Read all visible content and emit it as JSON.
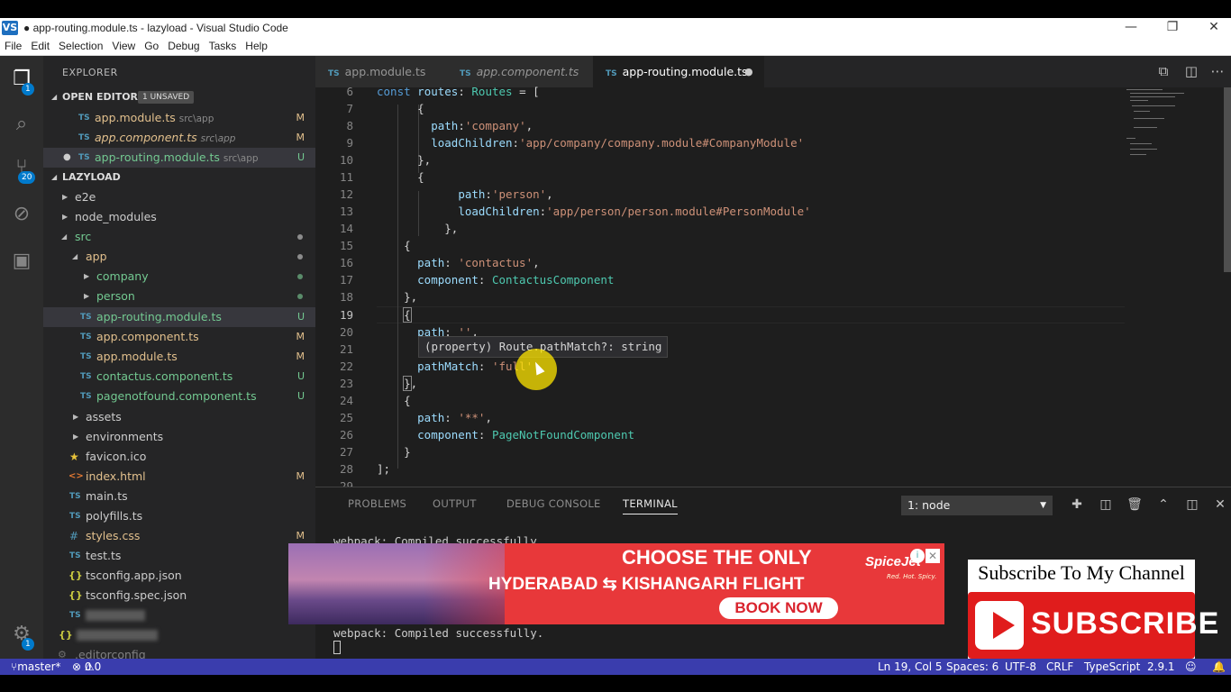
{
  "window": {
    "title": "● app-routing.module.ts - lazyload - Visual Studio Code",
    "logo": "VS",
    "controls": [
      "—",
      "❐",
      "✕"
    ]
  },
  "menu": [
    "File",
    "Edit",
    "Selection",
    "View",
    "Go",
    "Debug",
    "Tasks",
    "Help"
  ],
  "activity": {
    "explorer_badge": "1",
    "git_badge": "20",
    "settings_badge": "1"
  },
  "sidebar": {
    "title": "EXPLORER",
    "open_editors": {
      "header": "OPEN EDITORS",
      "badge": "1 UNSAVED",
      "items": [
        {
          "name": "app.module.ts",
          "path": "src\\app",
          "status": "M"
        },
        {
          "name": "app.component.ts",
          "path": "src\\app",
          "status": "M"
        },
        {
          "name": "app-routing.module.ts",
          "path": "src\\app",
          "status": "U"
        }
      ]
    },
    "project": {
      "header": "LAZYLOAD",
      "items": [
        {
          "name": "e2e",
          "status": ""
        },
        {
          "name": "node_modules",
          "status": ""
        },
        {
          "name": "src",
          "status": ""
        },
        {
          "name": "app",
          "status": ""
        },
        {
          "name": "company",
          "status": ""
        },
        {
          "name": "person",
          "status": ""
        },
        {
          "name": "app-routing.module.ts",
          "status": "U"
        },
        {
          "name": "app.component.ts",
          "status": "M"
        },
        {
          "name": "app.module.ts",
          "status": "M"
        },
        {
          "name": "contactus.component.ts",
          "status": "U"
        },
        {
          "name": "pagenotfound.component.ts",
          "status": "U"
        },
        {
          "name": "assets",
          "status": ""
        },
        {
          "name": "environments",
          "status": ""
        },
        {
          "name": "favicon.ico",
          "status": ""
        },
        {
          "name": "index.html",
          "status": "M"
        },
        {
          "name": "main.ts",
          "status": ""
        },
        {
          "name": "polyfills.ts",
          "status": ""
        },
        {
          "name": "styles.css",
          "status": "M"
        },
        {
          "name": "test.ts",
          "status": ""
        },
        {
          "name": "tsconfig.app.json",
          "status": ""
        },
        {
          "name": "tsconfig.spec.json",
          "status": ""
        },
        {
          "name": ".editorconfig",
          "status": ""
        }
      ]
    }
  },
  "tabs": [
    {
      "label": "app.module.ts",
      "icon": "TS"
    },
    {
      "label": "app.component.ts",
      "icon": "TS"
    },
    {
      "label": "app-routing.module.ts",
      "icon": "TS",
      "dirty": "●"
    }
  ],
  "editor": {
    "line_numbers": [
      "6",
      "7",
      "8",
      "9",
      "10",
      "11",
      "12",
      "13",
      "14",
      "15",
      "16",
      "17",
      "18",
      "19",
      "20",
      "21",
      "22",
      "23",
      "24",
      "25",
      "26",
      "27",
      "28",
      "29"
    ],
    "hover": "(property) Route.pathMatch?: string"
  },
  "panel": {
    "tabs": [
      "PROBLEMS",
      "OUTPUT",
      "DEBUG CONSOLE",
      "TERMINAL"
    ],
    "terminal_select": "1: node",
    "terminal_lines": [
      "webpack: Compiled successfully.",
      "webpack: Compiled successfully."
    ]
  },
  "status": {
    "branch": "master*",
    "errors": "0",
    "warnings": "0",
    "position": "Ln 19, Col 5",
    "spaces": "Spaces: 6",
    "encoding": "UTF-8",
    "eol": "CRLF",
    "language": "TypeScript",
    "version": "2.9.1"
  },
  "ad": {
    "headline": "CHOOSE THE ONLY",
    "route": "HYDERABAD ⇆ KISHANGARH FLIGHT",
    "cta": "BOOK NOW",
    "brand": "SpiceJet",
    "tagline": "Red. Hot. Spicy."
  },
  "subscribe": {
    "caption": "Subscribe To My Channel",
    "button": "SUBSCRIBE"
  },
  "colors": {
    "status_bar": "#3a3dad",
    "modified": "#e2c08d",
    "untracked": "#73c991",
    "ts_icon": "#519aba"
  }
}
